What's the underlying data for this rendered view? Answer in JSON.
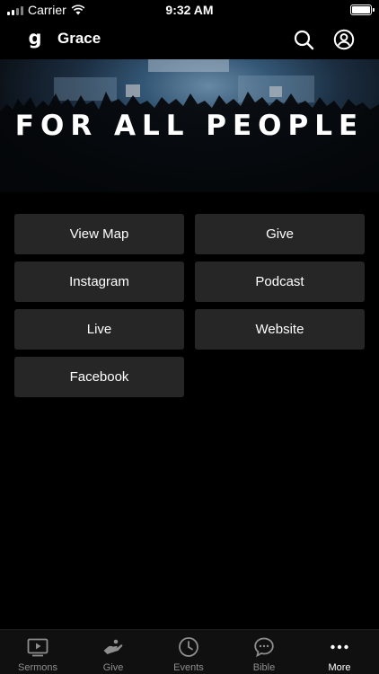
{
  "status_bar": {
    "carrier": "Carrier",
    "time": "9:32 AM"
  },
  "nav": {
    "logo_letter": "g",
    "title": "Grace"
  },
  "hero": {
    "text": "FOR ALL PEOPLE"
  },
  "links": [
    {
      "label": "View Map"
    },
    {
      "label": "Give"
    },
    {
      "label": "Instagram"
    },
    {
      "label": "Podcast"
    },
    {
      "label": "Live"
    },
    {
      "label": "Website"
    },
    {
      "label": "Facebook"
    }
  ],
  "tabs": [
    {
      "label": "Sermons",
      "icon": "play-screen-icon",
      "active": false
    },
    {
      "label": "Give",
      "icon": "giving-hand-icon",
      "active": false
    },
    {
      "label": "Events",
      "icon": "clock-icon",
      "active": false
    },
    {
      "label": "Bible",
      "icon": "chat-bubble-icon",
      "active": false
    },
    {
      "label": "More",
      "icon": "more-dots-icon",
      "active": true
    }
  ],
  "colors": {
    "background": "#000000",
    "button": "#262626",
    "tab_inactive": "#8e8e8e",
    "tab_active": "#ffffff"
  }
}
